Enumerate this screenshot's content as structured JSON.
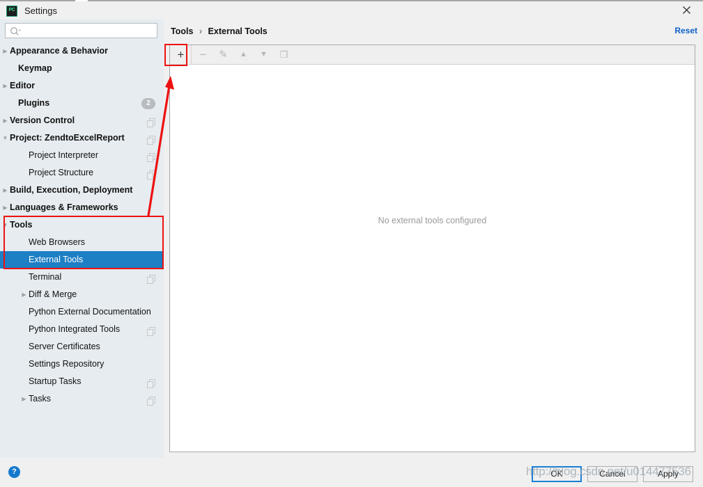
{
  "window": {
    "title": "Settings",
    "app_icon": "pycharm-icon",
    "app_icon_text": "PC",
    "close_icon": "close-icon"
  },
  "sidebar": {
    "search": {
      "placeholder": "",
      "value": "",
      "icon": "search-icon"
    },
    "items": [
      {
        "label": "Appearance & Behavior",
        "indent": 14,
        "bold": true,
        "arrow": "collapsed",
        "badge": null,
        "copy": false,
        "selected": false
      },
      {
        "label": "Keymap",
        "indent": 26,
        "bold": true,
        "arrow": null,
        "badge": null,
        "copy": false,
        "selected": false
      },
      {
        "label": "Editor",
        "indent": 14,
        "bold": true,
        "arrow": "collapsed",
        "badge": null,
        "copy": false,
        "selected": false
      },
      {
        "label": "Plugins",
        "indent": 26,
        "bold": true,
        "arrow": null,
        "badge": "2",
        "copy": false,
        "selected": false
      },
      {
        "label": "Version Control",
        "indent": 14,
        "bold": true,
        "arrow": "collapsed",
        "badge": null,
        "copy": true,
        "selected": false
      },
      {
        "label": "Project: ZendtoExcelReport",
        "indent": 14,
        "bold": true,
        "arrow": "expanded",
        "badge": null,
        "copy": true,
        "selected": false
      },
      {
        "label": "Project Interpreter",
        "indent": 41,
        "bold": false,
        "arrow": null,
        "badge": null,
        "copy": true,
        "selected": false
      },
      {
        "label": "Project Structure",
        "indent": 41,
        "bold": false,
        "arrow": null,
        "badge": null,
        "copy": true,
        "selected": false
      },
      {
        "label": "Build, Execution, Deployment",
        "indent": 14,
        "bold": true,
        "arrow": "collapsed",
        "badge": null,
        "copy": false,
        "selected": false
      },
      {
        "label": "Languages & Frameworks",
        "indent": 14,
        "bold": true,
        "arrow": "collapsed",
        "badge": null,
        "copy": false,
        "selected": false
      },
      {
        "label": "Tools",
        "indent": 14,
        "bold": true,
        "arrow": "expanded",
        "badge": null,
        "copy": false,
        "selected": false
      },
      {
        "label": "Web Browsers",
        "indent": 41,
        "bold": false,
        "arrow": null,
        "badge": null,
        "copy": false,
        "selected": false
      },
      {
        "label": "External Tools",
        "indent": 41,
        "bold": false,
        "arrow": null,
        "badge": null,
        "copy": false,
        "selected": true
      },
      {
        "label": "Terminal",
        "indent": 41,
        "bold": false,
        "arrow": null,
        "badge": null,
        "copy": true,
        "selected": false
      },
      {
        "label": "Diff & Merge",
        "indent": 41,
        "bold": false,
        "arrow": "collapsed",
        "badge": null,
        "copy": false,
        "selected": false
      },
      {
        "label": "Python External Documentation",
        "indent": 41,
        "bold": false,
        "arrow": null,
        "badge": null,
        "copy": false,
        "selected": false
      },
      {
        "label": "Python Integrated Tools",
        "indent": 41,
        "bold": false,
        "arrow": null,
        "badge": null,
        "copy": true,
        "selected": false
      },
      {
        "label": "Server Certificates",
        "indent": 41,
        "bold": false,
        "arrow": null,
        "badge": null,
        "copy": false,
        "selected": false
      },
      {
        "label": "Settings Repository",
        "indent": 41,
        "bold": false,
        "arrow": null,
        "badge": null,
        "copy": false,
        "selected": false
      },
      {
        "label": "Startup Tasks",
        "indent": 41,
        "bold": false,
        "arrow": null,
        "badge": null,
        "copy": true,
        "selected": false
      },
      {
        "label": "Tasks",
        "indent": 41,
        "bold": false,
        "arrow": "collapsed",
        "badge": null,
        "copy": true,
        "selected": false
      }
    ]
  },
  "content": {
    "breadcrumb": {
      "root": "Tools",
      "separator": "›",
      "current": "External Tools"
    },
    "reset_label": "Reset",
    "toolbar": [
      {
        "icon": "plus-icon",
        "glyph": "+",
        "disabled": false,
        "name": "add-tool-button"
      },
      {
        "icon": "minus-icon",
        "glyph": "−",
        "disabled": true,
        "name": "remove-tool-button"
      },
      {
        "icon": "pencil-icon",
        "glyph": "✎",
        "disabled": true,
        "name": "edit-tool-button"
      },
      {
        "icon": "arrow-up-icon",
        "glyph": "▲",
        "disabled": true,
        "name": "move-up-button"
      },
      {
        "icon": "arrow-down-icon",
        "glyph": "▼",
        "disabled": true,
        "name": "move-down-button"
      },
      {
        "icon": "copy-icon",
        "glyph": "❐",
        "disabled": true,
        "name": "copy-tool-button"
      }
    ],
    "empty_message": "No external tools configured"
  },
  "footer": {
    "help_icon": "help-icon",
    "help_glyph": "?",
    "ok_label": "OK",
    "cancel_label": "Cancel",
    "apply_label": "Apply"
  },
  "annotations": {
    "watermark": "http://blog.csdn.net/u014477536",
    "rect_color": "#ee1111",
    "arrow_color": "#ee1111"
  },
  "colors": {
    "selection": "#1d7fc4",
    "sidebar_bg": "#e6ecf0",
    "dialog_bg": "#f0f0f0",
    "panel_bg": "#ffffff",
    "link": "#0d62c9",
    "annotation": "#ee1111"
  }
}
